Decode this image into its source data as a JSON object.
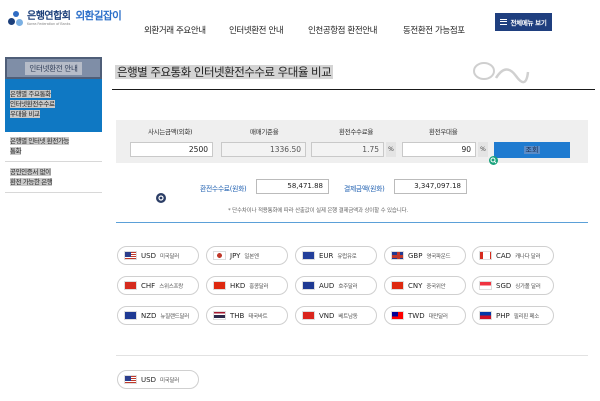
{
  "header": {
    "org": "은행연합회",
    "org_sub": "Korea Federation of Banks",
    "service": "외환길잡이",
    "nav": [
      "외환거래 주요안내",
      "인터넷환전 안내",
      "인천공항점 환전안내",
      "동전환전 가능점포"
    ],
    "all_menu_label": "전체메뉴 보기"
  },
  "sidebar": {
    "title": "인터넷환전 안내",
    "items": [
      {
        "lines": [
          "은행별 주요통화",
          "인터넷환전수수료",
          "우대율 비교"
        ],
        "active": true
      },
      {
        "lines": [
          "은행별 인터넷 환전가능",
          "통화"
        ],
        "active": false
      },
      {
        "lines": [
          "공인인증서 없이",
          "환전 가능한 은행"
        ],
        "active": false
      }
    ]
  },
  "main": {
    "title": "은행별 주요통화 인터넷환전수수료 우대율 비교",
    "calc": {
      "labels": [
        "사시는금액(외화)",
        "매매기준율",
        "환전수수료율",
        "환전우대율"
      ],
      "amount": "2500",
      "base_rate": "1336.50",
      "fee_rate": "1.75",
      "pct_symbol": "%",
      "discount": "90",
      "button_label": "조회"
    },
    "result": {
      "fee_label": "환전수수료(원화)",
      "fee_value": "58,471.88",
      "pay_label": "결제금액(원화)",
      "pay_value": "3,347,097.18"
    },
    "note": "* 단수차이나 적용통화에 따라 산출값이 실제 은행 결제금액과 상이할 수 있습니다.",
    "currencies": [
      {
        "code": "USD",
        "name": "미국달러",
        "flag": "us"
      },
      {
        "code": "JPY",
        "name": "일본엔",
        "flag": "jp"
      },
      {
        "code": "EUR",
        "name": "유럽유로",
        "flag": "eu"
      },
      {
        "code": "GBP",
        "name": "영국파운드",
        "flag": "gb"
      },
      {
        "code": "CAD",
        "name": "캐나다 달러",
        "flag": "ca"
      },
      {
        "code": "CHF",
        "name": "스위스프랑",
        "flag": "ch"
      },
      {
        "code": "HKD",
        "name": "홍콩달러",
        "flag": "hk"
      },
      {
        "code": "AUD",
        "name": "호주달러",
        "flag": "au"
      },
      {
        "code": "CNY",
        "name": "중국위안",
        "flag": "cn"
      },
      {
        "code": "SGD",
        "name": "싱가폴 달러",
        "flag": "sg"
      },
      {
        "code": "NZD",
        "name": "뉴질랜드달러",
        "flag": "nz"
      },
      {
        "code": "THB",
        "name": "태국바트",
        "flag": "th"
      },
      {
        "code": "VND",
        "name": "베트남동",
        "flag": "vn"
      },
      {
        "code": "TWD",
        "name": "대만달러",
        "flag": "tw"
      },
      {
        "code": "PHP",
        "name": "필리핀 페소",
        "flag": "ph"
      }
    ],
    "selected": {
      "code": "USD",
      "name": "미국달러",
      "flag": "us"
    }
  }
}
